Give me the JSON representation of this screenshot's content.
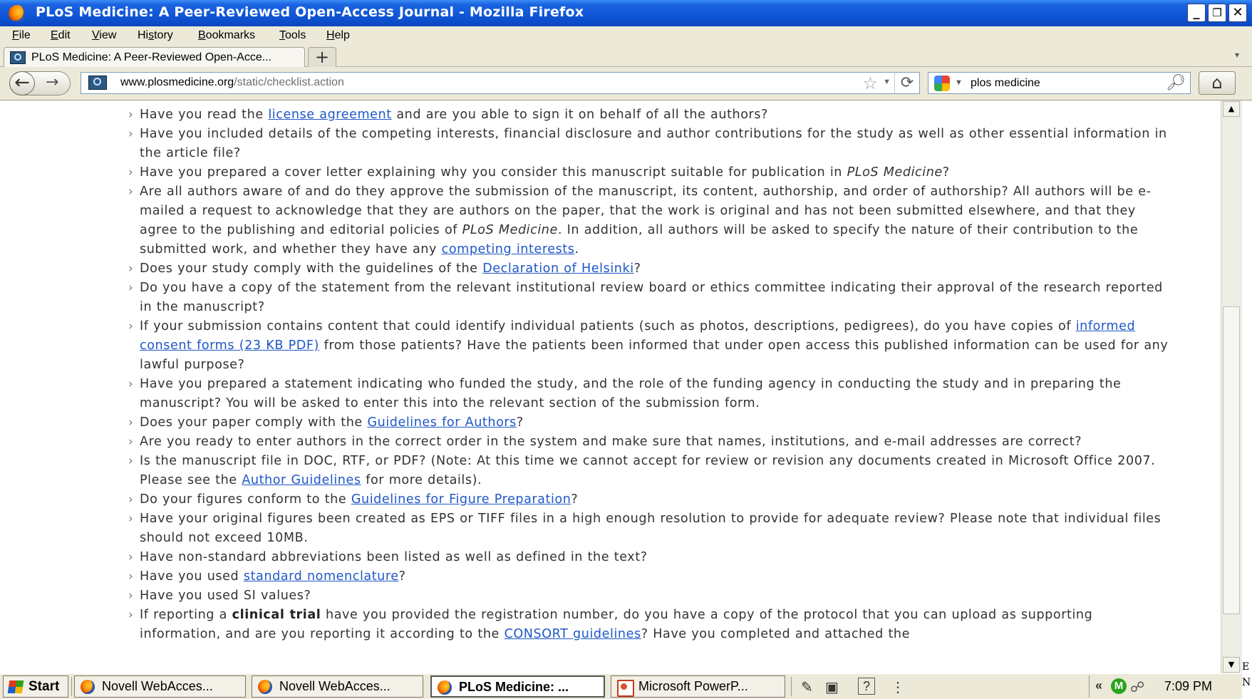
{
  "window": {
    "title": "PLoS Medicine: A Peer-Reviewed Open-Access Journal - Mozilla Firefox",
    "min_symbol": "_",
    "max_symbol": "❐",
    "close_symbol": "✕"
  },
  "menu": {
    "items": [
      {
        "label": "File",
        "mnemonic": "F"
      },
      {
        "label": "Edit",
        "mnemonic": "E"
      },
      {
        "label": "View",
        "mnemonic": "V"
      },
      {
        "label": "History",
        "mnemonic": "s"
      },
      {
        "label": "Bookmarks",
        "mnemonic": "B"
      },
      {
        "label": "Tools",
        "mnemonic": "T"
      },
      {
        "label": "Help",
        "mnemonic": "H"
      }
    ]
  },
  "tabs": {
    "active_label": "PLoS Medicine: A Peer-Reviewed Open-Acce...",
    "new_tab_symbol": "+",
    "list_symbol": "▾"
  },
  "navigation": {
    "url_host": "www.plosmedicine.org",
    "url_path": "/static/checklist.action",
    "search_query": "plos medicine",
    "back_symbol": "←",
    "forward_symbol": "→",
    "reload_symbol": "⟳",
    "star_symbol": "☆",
    "home_symbol": "⌂",
    "search_icon": "magnifier-icon"
  },
  "checklist": {
    "items": [
      {
        "parts": [
          {
            "t": "Have you read the "
          },
          {
            "t": "license agreement",
            "link": true
          },
          {
            "t": " and are you able to sign it on behalf of all the authors?"
          }
        ]
      },
      {
        "parts": [
          {
            "t": "Have you included details of the competing interests, financial disclosure and author contributions for the study as well as other essential information in the article file?"
          }
        ]
      },
      {
        "parts": [
          {
            "t": "Have you prepared a cover letter explaining why you consider this manuscript suitable for publication in "
          },
          {
            "t": "PLoS Medicine",
            "em": true
          },
          {
            "t": "?"
          }
        ]
      },
      {
        "parts": [
          {
            "t": "Are all authors aware of and do they approve the submission of the manuscript, its content, authorship, and order of authorship? All authors will be e-mailed a request to acknowledge that they are authors on the paper, that the work is original and has not been submitted elsewhere, and that they agree to the publishing and editorial policies of "
          },
          {
            "t": "PLoS Medicine",
            "em": true
          },
          {
            "t": ". In addition, all authors will be asked to specify the nature of their contribution to the submitted work, and whether they have any "
          },
          {
            "t": "competing interests",
            "link": true
          },
          {
            "t": "."
          }
        ]
      },
      {
        "parts": [
          {
            "t": "Does your study comply with the guidelines of the "
          },
          {
            "t": "Declaration of Helsinki",
            "link": true
          },
          {
            "t": "?"
          }
        ]
      },
      {
        "parts": [
          {
            "t": "Do you have a copy of the statement from the relevant institutional review board or ethics committee indicating their approval of the research reported in the manuscript?"
          }
        ]
      },
      {
        "parts": [
          {
            "t": "If your submission contains content that could identify individual patients (such as photos, descriptions, pedigrees), do you have copies of "
          },
          {
            "t": "informed consent forms (23 KB PDF)",
            "link": true
          },
          {
            "t": " from those patients? Have the patients been informed that under open access this published information can be used for any lawful purpose?"
          }
        ]
      },
      {
        "parts": [
          {
            "t": "Have you prepared a statement indicating who funded the study, and the role of the funding agency in conducting the study and in preparing the manuscript? You will be asked to enter this into the relevant section of the submission form."
          }
        ]
      },
      {
        "parts": [
          {
            "t": "Does your paper comply with the "
          },
          {
            "t": "Guidelines for Authors",
            "link": true
          },
          {
            "t": "?"
          }
        ]
      },
      {
        "parts": [
          {
            "t": "Are you ready to enter authors in the correct order in the system and make sure that names, institutions, and e-mail addresses are correct?"
          }
        ]
      },
      {
        "parts": [
          {
            "t": "Is the manuscript file in DOC, RTF, or PDF? (Note: At this time we cannot accept for review or revision any documents created in Microsoft Office 2007. Please see the "
          },
          {
            "t": "Author Guidelines",
            "link": true
          },
          {
            "t": " for more details)."
          }
        ]
      },
      {
        "parts": [
          {
            "t": "Do your figures conform to the "
          },
          {
            "t": "Guidelines for Figure Preparation",
            "link": true
          },
          {
            "t": "?"
          }
        ]
      },
      {
        "parts": [
          {
            "t": "Have your original figures been created as EPS or TIFF files in a high enough resolution to provide for adequate review? Please note that individual files should not exceed 10MB."
          }
        ]
      },
      {
        "parts": [
          {
            "t": "Have non-standard abbreviations been listed as well as defined in the text?"
          }
        ]
      },
      {
        "parts": [
          {
            "t": "Have you used "
          },
          {
            "t": "standard nomenclature",
            "link": true
          },
          {
            "t": "?"
          }
        ]
      },
      {
        "parts": [
          {
            "t": "Have you used SI values?"
          }
        ]
      },
      {
        "parts": [
          {
            "t": "If reporting a "
          },
          {
            "t": "clinical trial",
            "strong": true
          },
          {
            "t": " have you provided the registration number, do you have a copy of the protocol that you can upload as supporting information, and are you reporting it according to the "
          },
          {
            "t": "CONSORT guidelines",
            "link": true
          },
          {
            "t": "? Have you completed and attached the"
          }
        ]
      }
    ]
  },
  "taskbar": {
    "start_label": "Start",
    "tasks": [
      {
        "label": "Novell WebAcces...",
        "icon": "firefox-icon",
        "active": false
      },
      {
        "label": "Novell WebAcces...",
        "icon": "firefox-icon",
        "active": false
      },
      {
        "label": "PLoS Medicine: ...",
        "icon": "firefox-icon",
        "active": true
      },
      {
        "label": "Microsoft PowerP...",
        "icon": "powerpoint-icon",
        "active": false
      }
    ],
    "clock": "7:09 PM",
    "tray_chevron": "«",
    "tray_m_label": "M"
  },
  "edge_glyphs": {
    "top": "E",
    "bottom": "N"
  }
}
